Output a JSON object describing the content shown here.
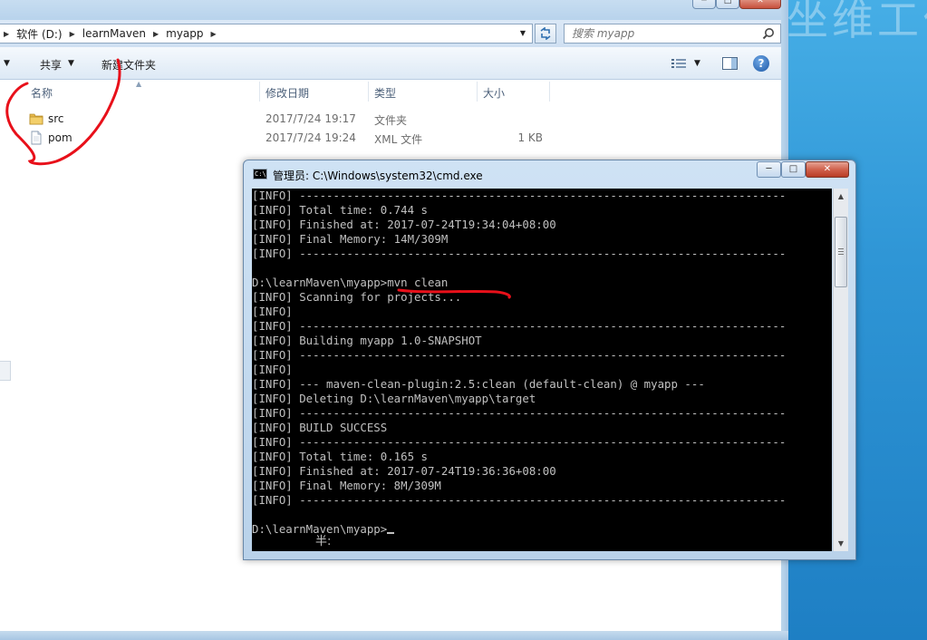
{
  "desktop": {
    "background_text": "坐维工作"
  },
  "explorer": {
    "address": {
      "crumbs": [
        "软件 (D:)",
        "learnMaven",
        "myapp"
      ],
      "dropdown_glyph": "▼"
    },
    "search": {
      "placeholder": "搜索 myapp"
    },
    "toolbar": {
      "share_label": "共享",
      "new_folder_label": "新建文件夹"
    },
    "columns": {
      "name": "名称",
      "modified": "修改日期",
      "type": "类型",
      "size": "大小"
    },
    "files": [
      {
        "name": "src",
        "modified": "2017/7/24 19:17",
        "type": "文件夹",
        "size": "",
        "icon": "folder-icon"
      },
      {
        "name": "pom",
        "modified": "2017/7/24 19:24",
        "type": "XML 文件",
        "size": "1 KB",
        "icon": "xml-file-icon"
      }
    ]
  },
  "cmd": {
    "title": "管理员: C:\\Windows\\system32\\cmd.exe",
    "lines": [
      "[INFO] ------------------------------------------------------------------------",
      "[INFO] Total time: 0.744 s",
      "[INFO] Finished at: 2017-07-24T19:34:04+08:00",
      "[INFO] Final Memory: 14M/309M",
      "[INFO] ------------------------------------------------------------------------",
      "",
      "D:\\learnMaven\\myapp>mvn clean",
      "[INFO] Scanning for projects...",
      "[INFO]",
      "[INFO] ------------------------------------------------------------------------",
      "[INFO] Building myapp 1.0-SNAPSHOT",
      "[INFO] ------------------------------------------------------------------------",
      "[INFO]",
      "[INFO] --- maven-clean-plugin:2.5:clean (default-clean) @ myapp ---",
      "[INFO] Deleting D:\\learnMaven\\myapp\\target",
      "[INFO] ------------------------------------------------------------------------",
      "[INFO] BUILD SUCCESS",
      "[INFO] ------------------------------------------------------------------------",
      "[INFO] Total time: 0.165 s",
      "[INFO] Finished at: 2017-07-24T19:36:36+08:00",
      "[INFO] Final Memory: 8M/309M",
      "[INFO] ------------------------------------------------------------------------",
      "",
      "D:\\learnMaven\\myapp>"
    ],
    "ime_indicator": "半:",
    "scroll_position_fraction": 0.05
  },
  "colors": {
    "annotation_red": "#e8101a",
    "console_text": "#c0c0c0",
    "console_bg": "#000000"
  }
}
